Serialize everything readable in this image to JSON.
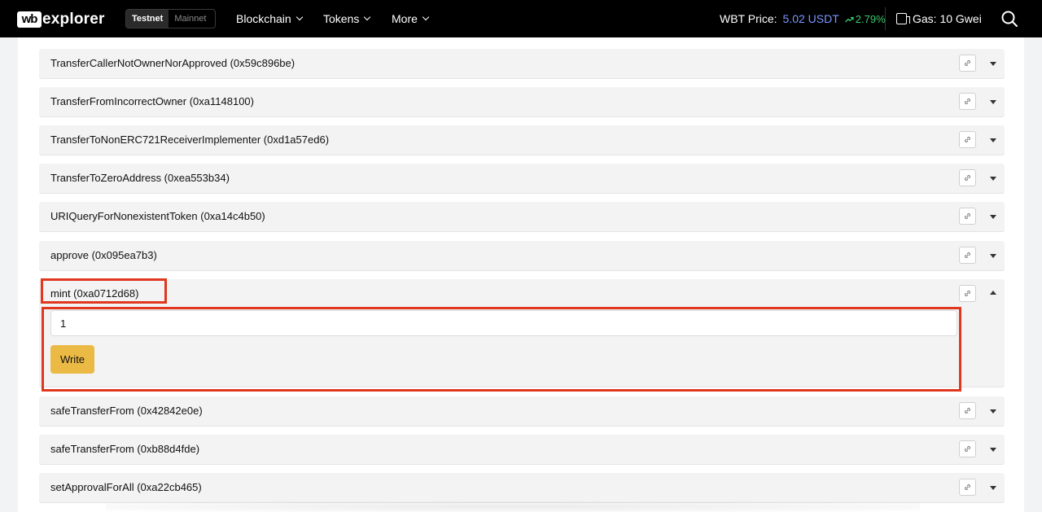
{
  "header": {
    "logo_mark": "wb",
    "logo_text": "explorer",
    "network": {
      "options": [
        "Testnet",
        "Mainnet"
      ],
      "selected": "Testnet"
    },
    "nav": [
      {
        "label": "Blockchain"
      },
      {
        "label": "Tokens"
      },
      {
        "label": "More"
      }
    ],
    "price_label": "WBT Price:",
    "price_value": "5.02 USDT",
    "price_change": "2.79%",
    "gas_label": "Gas: 10 Gwei"
  },
  "functions": [
    {
      "title": "TransferCallerNotOwnerNorApproved (0x59c896be)",
      "expanded": false
    },
    {
      "title": "TransferFromIncorrectOwner (0xa1148100)",
      "expanded": false
    },
    {
      "title": "TransferToNonERC721ReceiverImplementer (0xd1a57ed6)",
      "expanded": false
    },
    {
      "title": "TransferToZeroAddress (0xea553b34)",
      "expanded": false
    },
    {
      "title": "URIQueryForNonexistentToken (0xa14c4b50)",
      "expanded": false
    },
    {
      "title": "approve (0x095ea7b3)",
      "expanded": false
    },
    {
      "title": "mint (0xa0712d68)",
      "expanded": true,
      "input_value": "1",
      "write_label": "Write"
    },
    {
      "title": "safeTransferFrom (0x42842e0e)",
      "expanded": false
    },
    {
      "title": "safeTransferFrom (0xb88d4fde)",
      "expanded": false
    },
    {
      "title": "setApprovalForAll (0xa22cb465)",
      "expanded": false
    }
  ],
  "colors": {
    "accent": "#ebba45",
    "price": "#7c96ff",
    "positive": "#3cc86a",
    "highlight": "#e0371f"
  }
}
